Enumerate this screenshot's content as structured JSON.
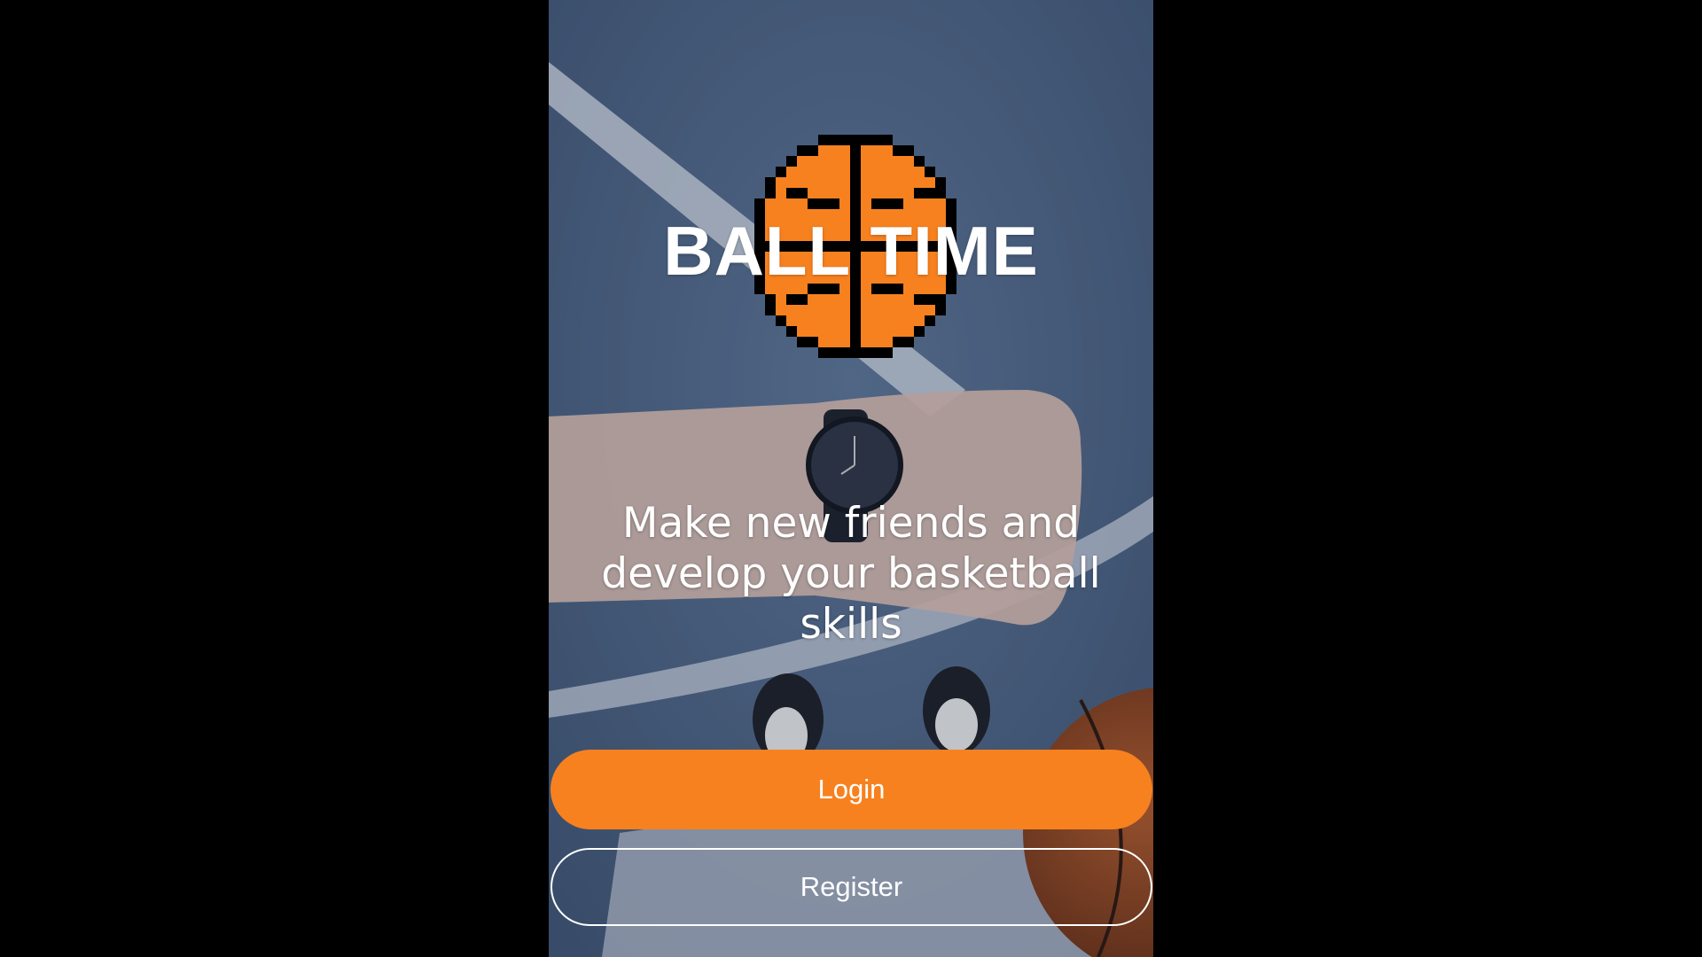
{
  "app": {
    "title": "BALL TIME",
    "logo_icon": "pixel-basketball-icon",
    "tagline": "Make new friends and develop your basketball skills"
  },
  "actions": {
    "login_label": "Login",
    "register_label": "Register"
  },
  "colors": {
    "accent": "#f7811f",
    "ball_fill": "#f7811f",
    "ball_outline": "#000000",
    "text": "#ffffff",
    "background_overlay": "#4f6483"
  }
}
